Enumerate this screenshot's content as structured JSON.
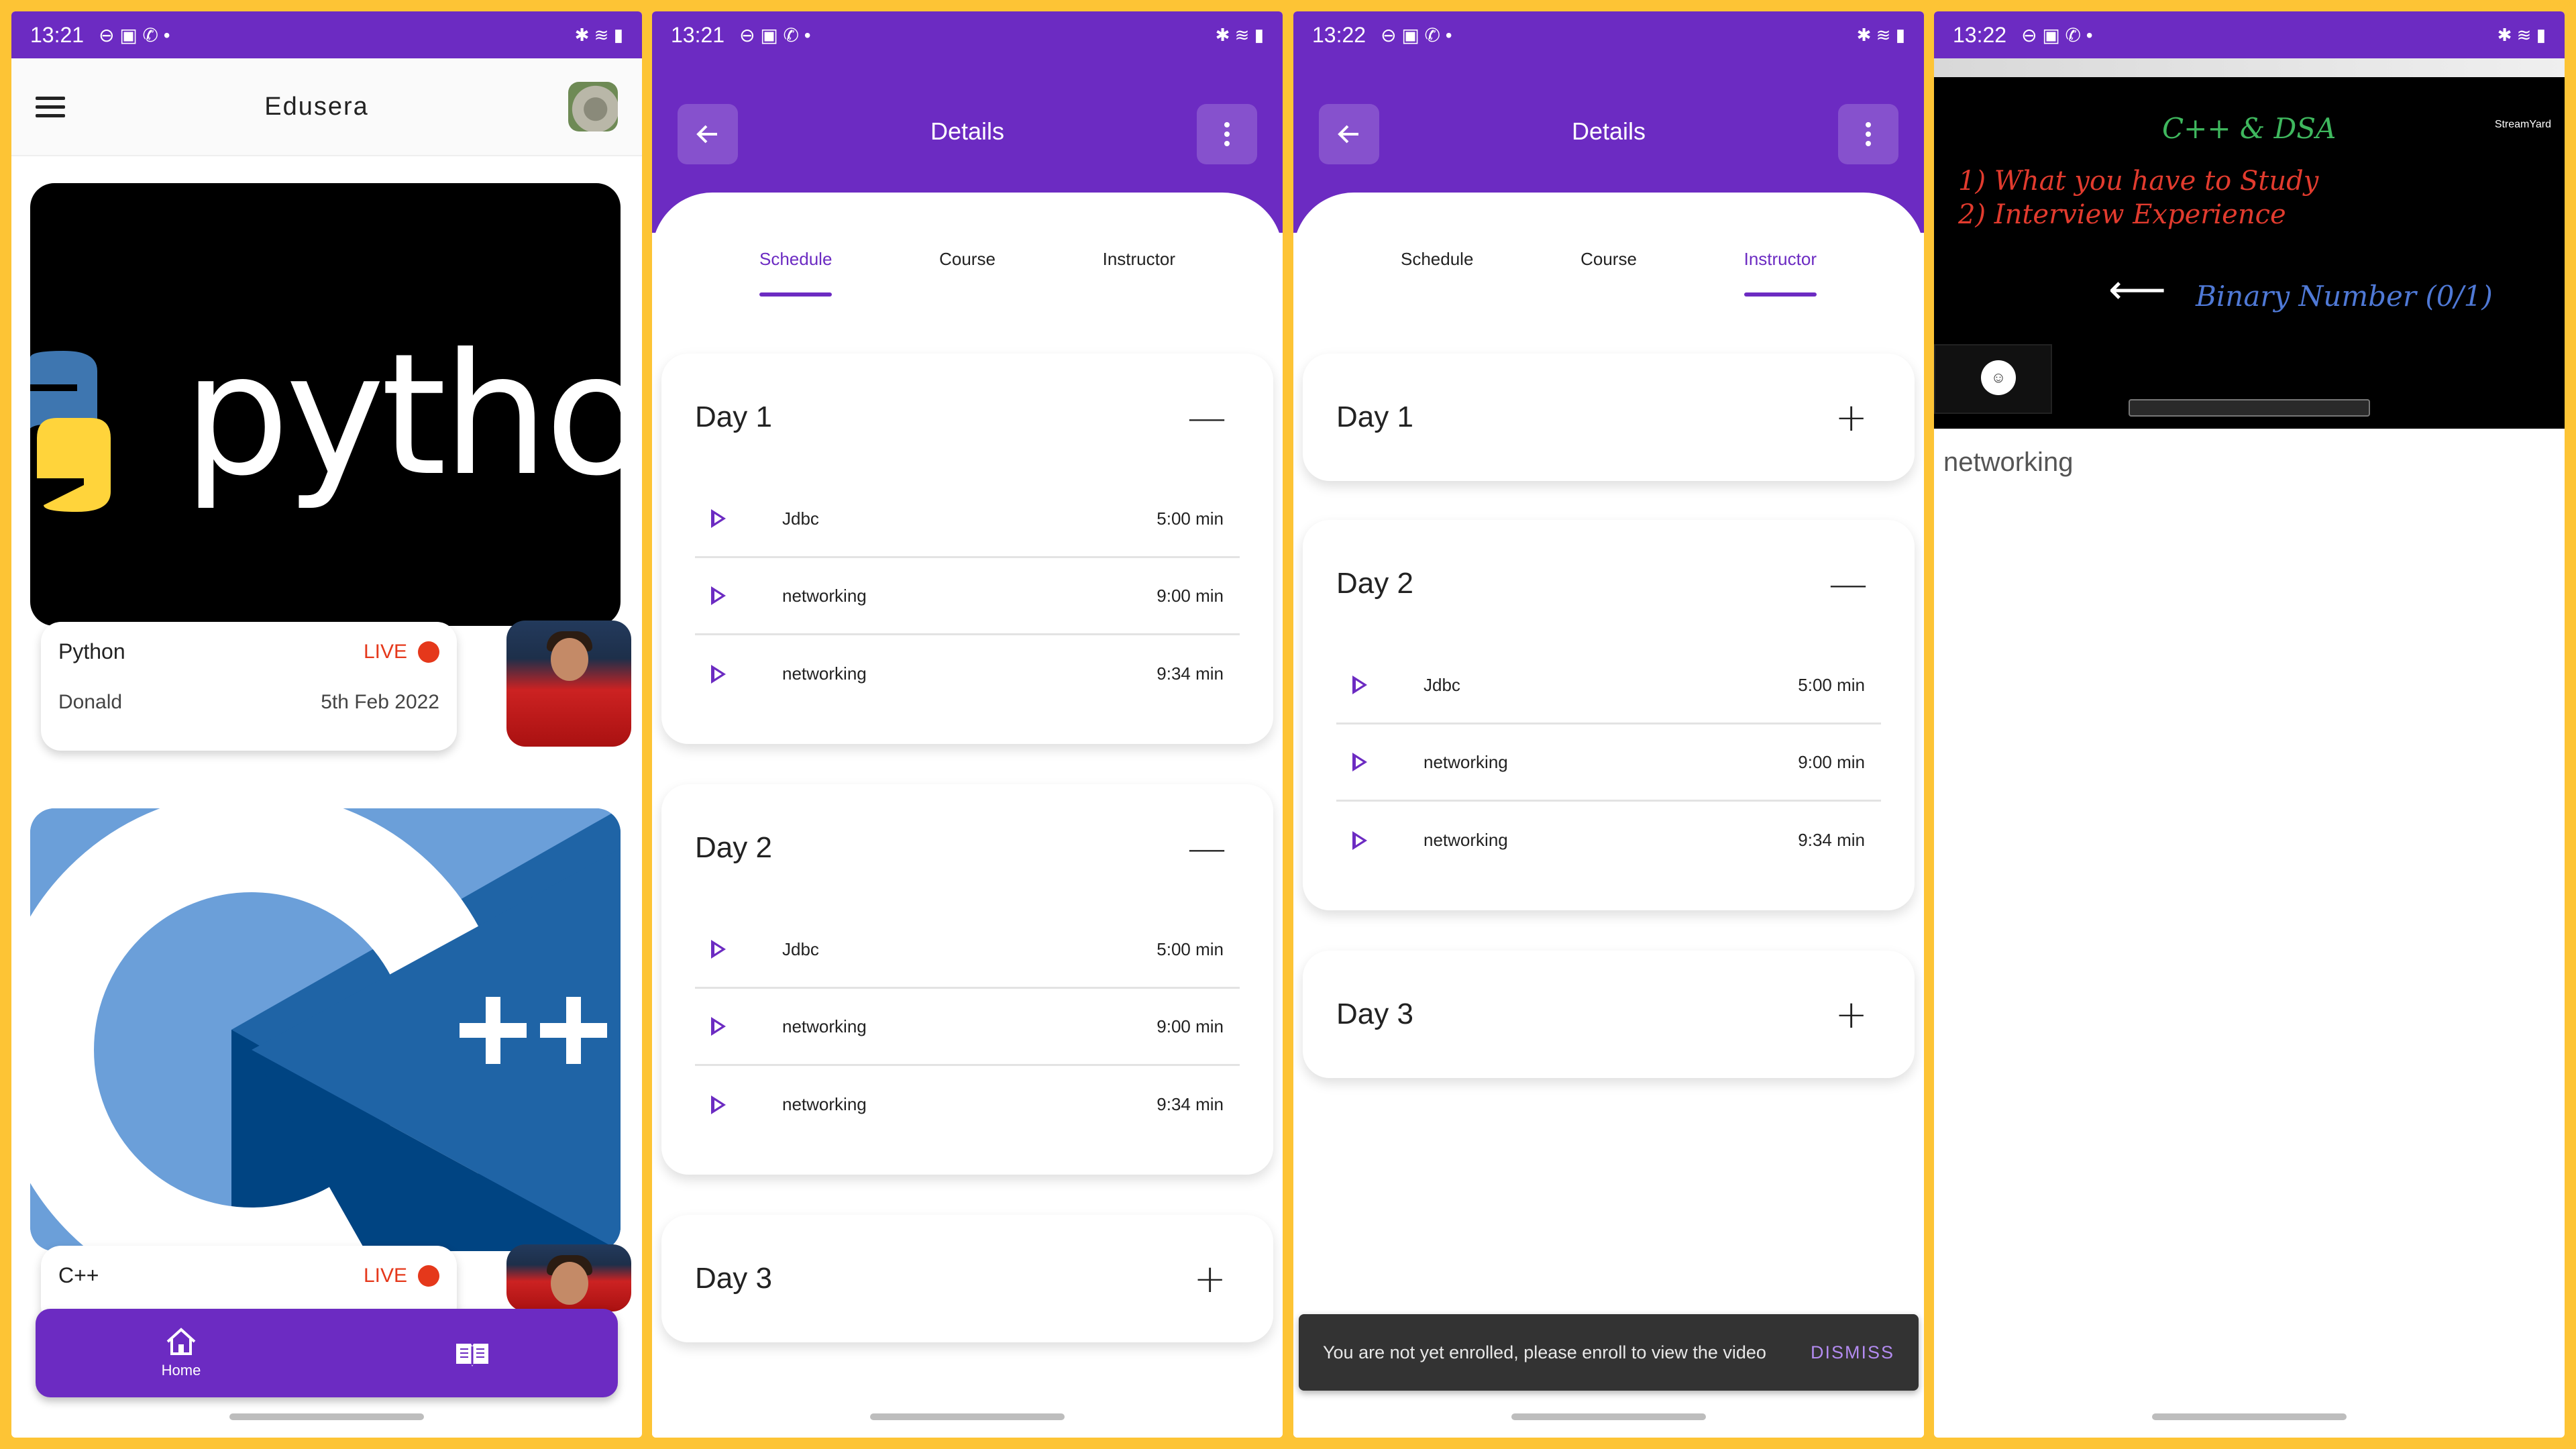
{
  "colors": {
    "primary": "#6C2BC2",
    "background": "#FDC435",
    "live": "#E5381B"
  },
  "panel1": {
    "status": {
      "time": "13:21"
    },
    "app_title": "Edusera",
    "courses": [
      {
        "image_text": "python",
        "name": "Python",
        "live_label": "LIVE",
        "instructor": "Donald",
        "date": "5th Feb 2022"
      },
      {
        "image_text": "",
        "name": "C++",
        "live_label": "LIVE"
      }
    ],
    "bottom_nav": {
      "home_label": "Home"
    }
  },
  "panel2": {
    "status": {
      "time": "13:21"
    },
    "title": "Details",
    "tabs": [
      "Schedule",
      "Course",
      "Instructor"
    ],
    "active_tab": "Schedule",
    "days": [
      {
        "title": "Day 1",
        "expanded": true,
        "lessons": [
          {
            "name": "Jdbc",
            "duration": "5:00 min"
          },
          {
            "name": "networking",
            "duration": "9:00 min"
          },
          {
            "name": "networking",
            "duration": "9:34 min"
          }
        ]
      },
      {
        "title": "Day 2",
        "expanded": true,
        "lessons": [
          {
            "name": "Jdbc",
            "duration": "5:00 min"
          },
          {
            "name": "networking",
            "duration": "9:00 min"
          },
          {
            "name": "networking",
            "duration": "9:34 min"
          }
        ]
      },
      {
        "title": "Day 3",
        "expanded": false,
        "lessons": []
      }
    ]
  },
  "panel3": {
    "status": {
      "time": "13:22"
    },
    "title": "Details",
    "tabs": [
      "Schedule",
      "Course",
      "Instructor"
    ],
    "active_tab": "Instructor",
    "days": [
      {
        "title": "Day 1",
        "expanded": false
      },
      {
        "title": "Day 2",
        "expanded": true,
        "lessons": [
          {
            "name": "Jdbc",
            "duration": "5:00 min"
          },
          {
            "name": "networking",
            "duration": "9:00 min"
          },
          {
            "name": "networking",
            "duration": "9:34 min"
          }
        ]
      },
      {
        "title": "Day 3",
        "expanded": false
      }
    ],
    "snackbar": {
      "message": "You are not yet enrolled, please enroll to view the video",
      "action": "DISMISS"
    }
  },
  "panel4": {
    "status": {
      "time": "13:22"
    },
    "video": {
      "title": "C++ & DSA",
      "line1": "1) What you have to Study",
      "line2": "2) Interview Experience",
      "line3": "Binary Number (0/1)",
      "brand": "StreamYard"
    },
    "caption": "networking"
  },
  "icons": [
    "hamburger-icon",
    "back-arrow-icon",
    "more-vert-icon",
    "home-icon",
    "book-icon",
    "play-icon",
    "minus-icon",
    "plus-icon"
  ]
}
